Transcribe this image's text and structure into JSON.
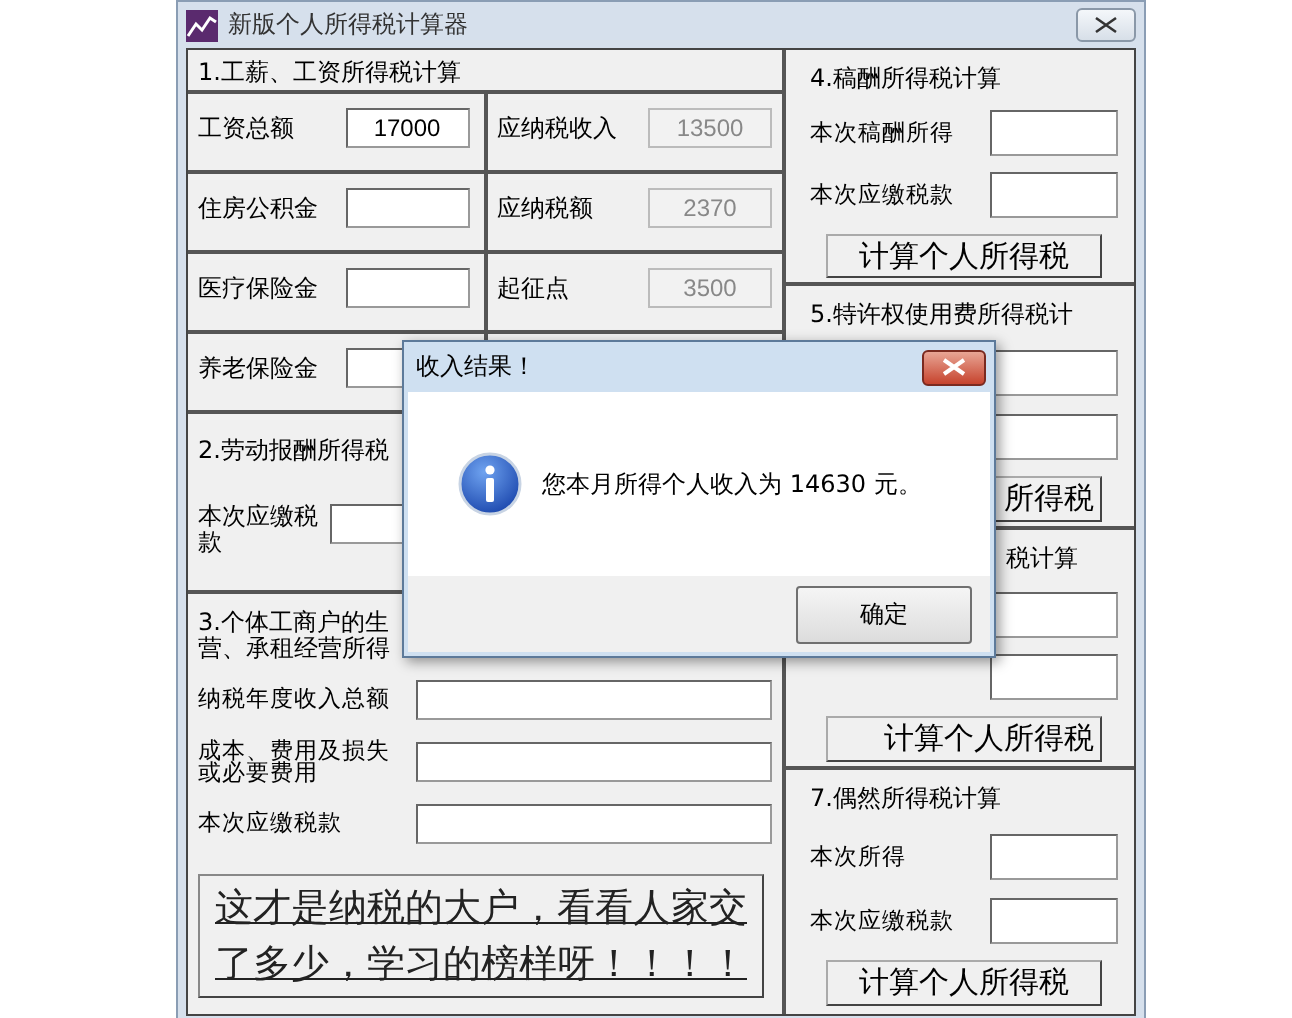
{
  "window": {
    "title": "新版个人所得税计算器"
  },
  "salary_section": {
    "title": "1.工薪、工资所得税计算",
    "rows": [
      [
        {
          "label": "工资总额",
          "value": "17000",
          "disabled": false
        },
        {
          "label": "应纳税收入",
          "value": "13500",
          "disabled": true
        }
      ],
      [
        {
          "label": "住房公积金",
          "disabled": false
        },
        {
          "label": "应纳税额",
          "value": "2370",
          "disabled": true
        }
      ],
      [
        {
          "label": "医疗保险金",
          "disabled": false
        },
        {
          "label": "起征点",
          "value": "3500",
          "disabled": true
        }
      ],
      [
        {
          "label": "养老保险金",
          "disabled": false
        }
      ]
    ]
  },
  "labor_section": {
    "title": "2.劳动报酬所得税",
    "fields": [
      {
        "label": "本次应缴税款"
      }
    ]
  },
  "business_section": {
    "title_lines": [
      "3.个体工商户的生",
      "营、承租经营所得"
    ],
    "fields": [
      {
        "label": "纳税年度收入总额"
      },
      {
        "label": "成本、费用及损失或必要费用"
      },
      {
        "label": "本次应缴税款"
      }
    ],
    "link_button": "这才是纳税的大户，看看人家交了多少，学习的榜样呀！！！！"
  },
  "right_sections": [
    {
      "kind": "open",
      "title": "4.稿酬所得税计算",
      "fields": [
        {
          "kind": "labeled",
          "label": "本次稿酬所得"
        },
        {
          "kind": "labeled",
          "label": "本次应缴税款"
        }
      ],
      "button": "计算个人所得税"
    },
    {
      "kind": "covered",
      "title": "5.特许权使用费所得税计",
      "fields": [
        {
          "kind": "bare"
        },
        {
          "kind": "bare"
        }
      ],
      "button": "所得税"
    },
    {
      "kind": "covered",
      "title": "税计算",
      "fields": [
        {
          "kind": "bare"
        },
        {
          "kind": "bare"
        }
      ],
      "button": "计算个人所得税"
    },
    {
      "kind": "open",
      "title": "7.偶然所得税计算",
      "fields": [
        {
          "kind": "labeled",
          "label": "本次所得"
        },
        {
          "kind": "labeled",
          "label": "本次应缴税款"
        }
      ],
      "button": "计算个人所得税"
    }
  ],
  "dialog": {
    "title": "收入结果！",
    "message": "您本月所得个人收入为 14630 元。",
    "button": "确定"
  }
}
